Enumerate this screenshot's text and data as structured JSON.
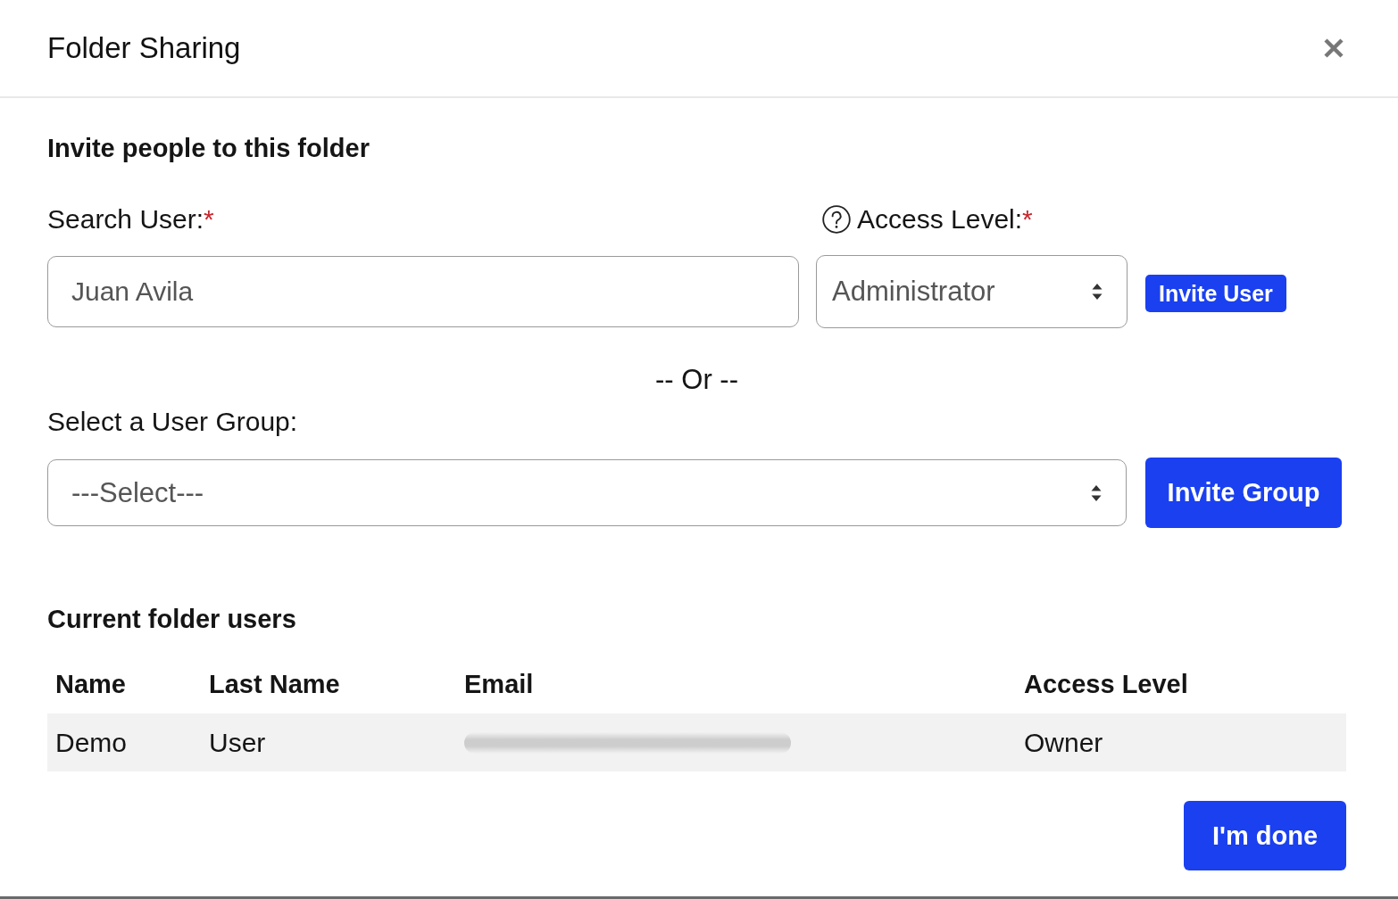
{
  "dialog": {
    "title": "Folder Sharing"
  },
  "invite": {
    "heading": "Invite people to this folder",
    "search_user": {
      "label": "Search User:",
      "required_mark": "*",
      "value": "Juan Avila"
    },
    "access_level": {
      "label": "Access Level:",
      "required_mark": "*",
      "value": "Administrator"
    },
    "invite_user_button": "Invite User",
    "separator": "-- Or --",
    "user_group": {
      "label": "Select a User Group:",
      "value": "---Select---"
    },
    "invite_group_button": "Invite Group"
  },
  "current_users": {
    "heading": "Current folder users",
    "columns": [
      "Name",
      "Last Name",
      "Email",
      "Access Level"
    ],
    "rows": [
      {
        "name": "Demo",
        "last_name": "User",
        "email_blurred": true,
        "access_level": "Owner"
      }
    ]
  },
  "done_button": "I'm done"
}
